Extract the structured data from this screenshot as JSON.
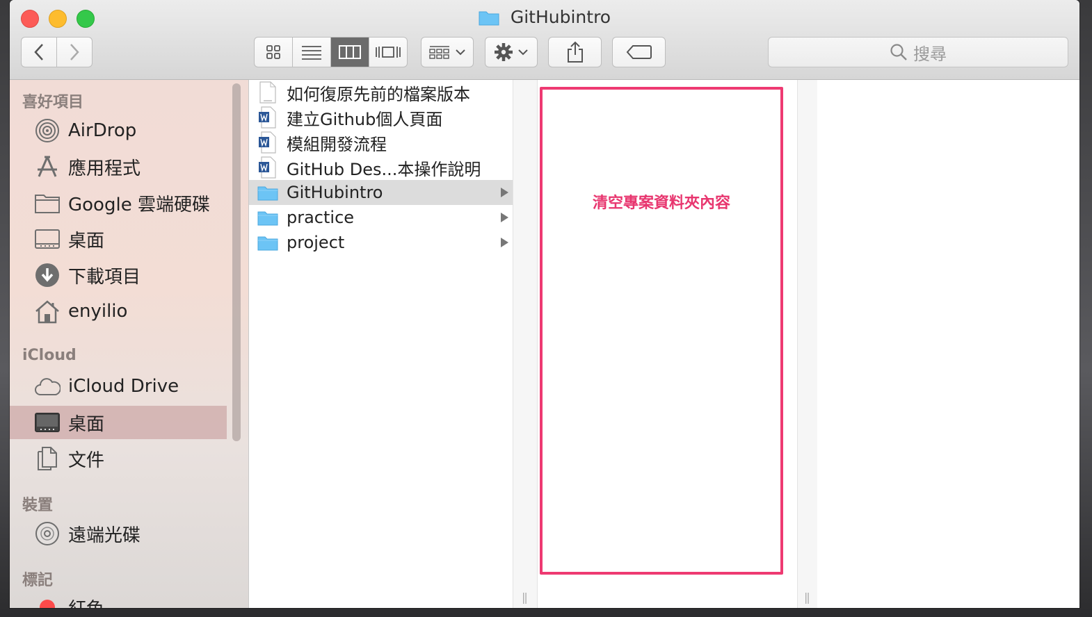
{
  "window": {
    "title": "GitHubintro"
  },
  "toolbar": {
    "search_placeholder": "搜尋",
    "view_mode_selected": "columns"
  },
  "sidebar": {
    "sections": [
      {
        "heading": "喜好項目",
        "items": [
          {
            "label": "AirDrop",
            "icon": "airdrop-icon"
          },
          {
            "label": "應用程式",
            "icon": "applications-icon"
          },
          {
            "label": "Google 雲端硬碟",
            "icon": "folder-icon"
          },
          {
            "label": "桌面",
            "icon": "desktop-icon"
          },
          {
            "label": "下載項目",
            "icon": "download-icon"
          },
          {
            "label": "enyilio",
            "icon": "home-icon"
          }
        ]
      },
      {
        "heading": "iCloud",
        "items": [
          {
            "label": "iCloud Drive",
            "icon": "cloud-icon"
          },
          {
            "label": "桌面",
            "icon": "desktop-icon",
            "selected": true
          },
          {
            "label": "文件",
            "icon": "documents-icon"
          }
        ]
      },
      {
        "heading": "裝置",
        "items": [
          {
            "label": "遠端光碟",
            "icon": "disc-icon"
          }
        ]
      },
      {
        "heading": "標記",
        "items": [
          {
            "label": "紅色",
            "icon": "red-tag-icon",
            "color": "#fc4a4a"
          }
        ]
      }
    ]
  },
  "column1": {
    "files": [
      {
        "name": "如何復原先前的檔案版本",
        "type": "docx"
      },
      {
        "name": "建立Github個人頁面",
        "type": "word"
      },
      {
        "name": "模組開發流程",
        "type": "word"
      },
      {
        "name": "GitHub Des...本操作說明",
        "type": "word"
      },
      {
        "name": "GitHubintro",
        "type": "folder",
        "selected": true
      },
      {
        "name": "practice",
        "type": "folder"
      },
      {
        "name": "project",
        "type": "folder"
      }
    ]
  },
  "annotation": {
    "text": "清空專案資料夾內容",
    "color": "#ee3a72"
  },
  "colors": {
    "folder": "#6cc4f5",
    "selection": "#dcdcdc",
    "sidebar_selection": "#c39696"
  }
}
